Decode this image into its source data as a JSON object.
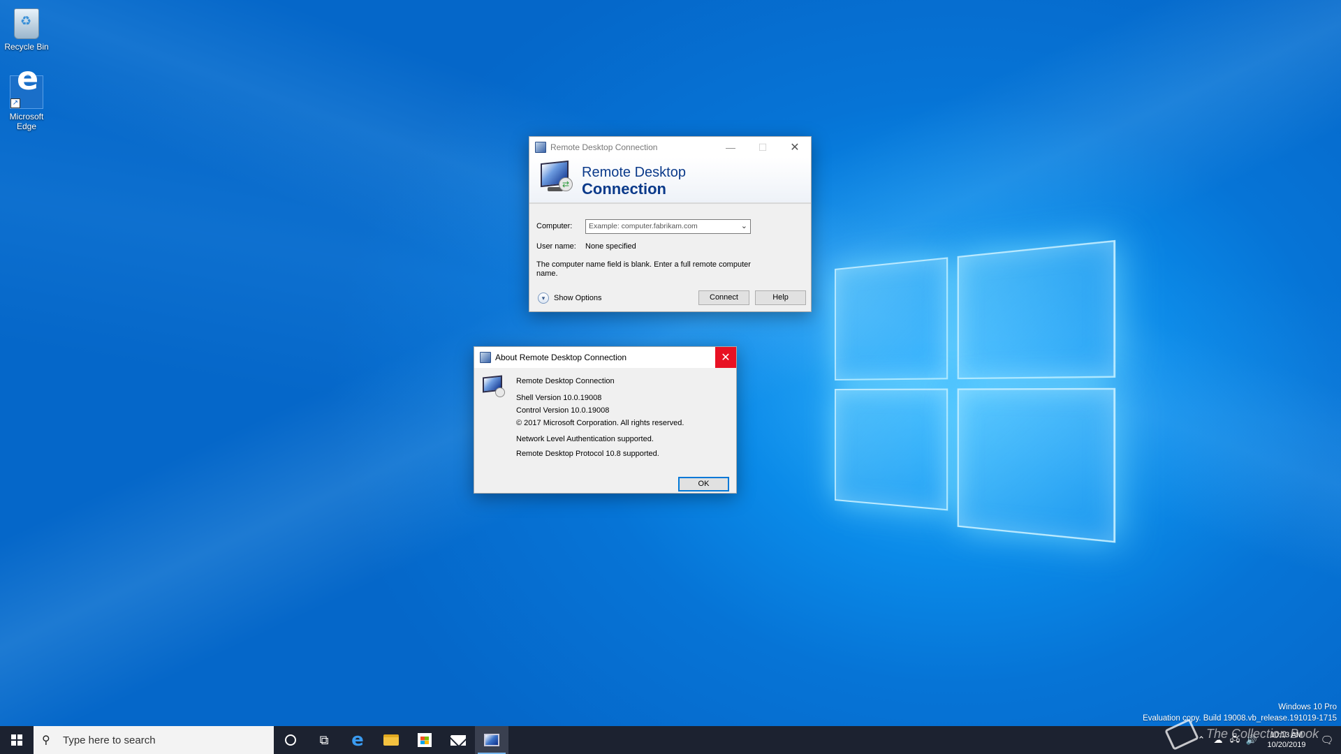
{
  "desktop": {
    "icons": [
      {
        "label": "Recycle Bin",
        "icon": "recycle-bin-icon"
      },
      {
        "label": "Microsoft Edge",
        "icon": "edge-icon"
      }
    ],
    "watermark": {
      "line1": "Windows 10 Pro",
      "line2": "Evaluation copy. Build 19008.vb_release.191019-1715"
    },
    "overlay_text": "The Collection Book"
  },
  "rdc_window": {
    "title": "Remote Desktop Connection",
    "banner_line1": "Remote Desktop",
    "banner_line2": "Connection",
    "computer_label": "Computer:",
    "computer_placeholder": "Example: computer.fabrikam.com",
    "username_label": "User name:",
    "username_value": "None specified",
    "message": "The computer name field is blank.  Enter a full remote computer name.",
    "show_options": "Show Options",
    "connect_button": "Connect",
    "help_button": "Help"
  },
  "about_window": {
    "title": "About Remote Desktop Connection",
    "app_name": "Remote Desktop Connection",
    "shell_version": "Shell Version 10.0.19008",
    "control_version": "Control Version 10.0.19008",
    "copyright": "© 2017 Microsoft Corporation. All rights reserved.",
    "nla": "Network Level Authentication supported.",
    "protocol": "Remote Desktop Protocol 10.8 supported.",
    "ok_button": "OK"
  },
  "taskbar": {
    "search_placeholder": "Type here to search",
    "pinned": [
      "cortana-icon",
      "task-view-icon",
      "edge-icon",
      "file-explorer-icon",
      "store-icon",
      "mail-icon",
      "remote-desktop-icon"
    ],
    "clock_time": "10:13 AM",
    "clock_date": "10/20/2019"
  },
  "colors": {
    "accent": "#0078d7",
    "close_red": "#e81123",
    "taskbar": "#1c2230",
    "desktop_blue": "#0a8ae8"
  }
}
